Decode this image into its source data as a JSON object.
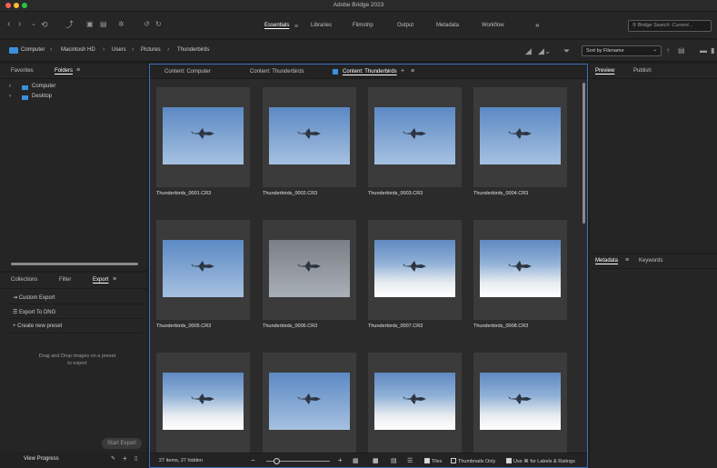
{
  "window": {
    "title": "Adobe Bridge 2023",
    "traffic_lights": [
      "#ff5f57",
      "#febc2e",
      "#28c840"
    ]
  },
  "toolbar": {
    "workspaces": [
      {
        "label": "Essentials"
      },
      {
        "label": "Libraries"
      },
      {
        "label": "Filmstrip"
      },
      {
        "label": "Output"
      },
      {
        "label": "Metadata"
      },
      {
        "label": "Workflow"
      }
    ],
    "more_label": "»",
    "search_placeholder": "Bridge Search: Current..."
  },
  "path": {
    "crumbs": [
      "Computer",
      "Macintosh HD",
      "Users",
      "Pictures",
      "Thunderbirds"
    ],
    "sort_label": "Sort by Filename"
  },
  "left_top": {
    "tabs": [
      "Favorites",
      "Folders"
    ],
    "folders": [
      "Computer",
      "Desktop"
    ]
  },
  "left_bottom": {
    "tabs": [
      "Collections",
      "Filter",
      "Export"
    ],
    "items": [
      "Custom Export",
      "Export To DNG",
      "Create new preset"
    ],
    "drop_hint": "Drag and Drop images on a preset to export",
    "start_export": "Start Export",
    "view_progress": "View Progress"
  },
  "content": {
    "tabs": [
      "Content: Computer",
      "Content: Thunderbirds",
      "Content: Thunderbirds"
    ],
    "files": [
      {
        "name": "Thunderbirds_0001.CR3",
        "style": "sky"
      },
      {
        "name": "Thunderbirds_0002.CR3",
        "style": "sky"
      },
      {
        "name": "Thunderbirds_0003.CR3",
        "style": "sky"
      },
      {
        "name": "Thunderbirds_0004.CR3",
        "style": "sky"
      },
      {
        "name": "Thunderbirds_0005.CR3",
        "style": "sky"
      },
      {
        "name": "Thunderbirds_0006.CR3",
        "style": "gray"
      },
      {
        "name": "Thunderbirds_0007.CR3",
        "style": "cloud"
      },
      {
        "name": "Thunderbirds_0008.CR3",
        "style": "cloud"
      },
      {
        "name": "",
        "style": "cloud"
      },
      {
        "name": "",
        "style": "sky"
      },
      {
        "name": "",
        "style": "cloud"
      },
      {
        "name": "",
        "style": "cloud"
      }
    ]
  },
  "status": {
    "count_text": "27 items, 27 hidden",
    "tiles_label": "Tiles",
    "thumbs_only_label": "Thumbnails Only",
    "labels_label": "Use ⌘ for Labels & Ratings"
  },
  "right": {
    "top_tabs": [
      "Preview",
      "Publish"
    ],
    "bottom_tabs": [
      "Metadata",
      "Keywords"
    ]
  }
}
